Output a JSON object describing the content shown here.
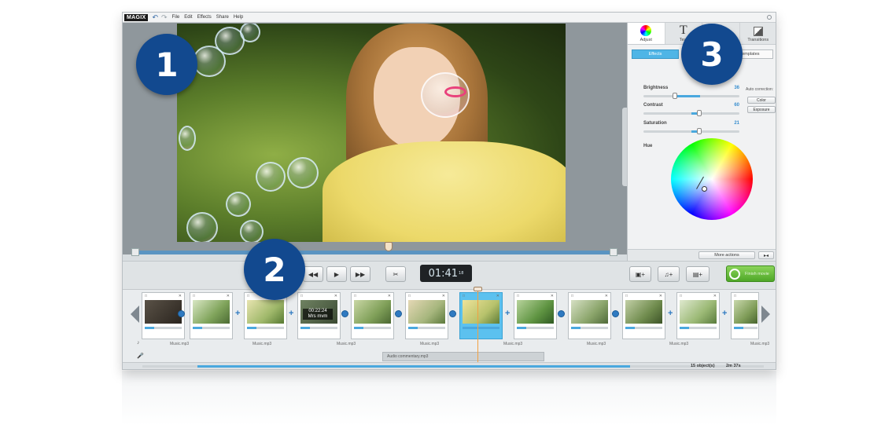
{
  "menubar": {
    "logo": "MAGIX",
    "items": [
      "File",
      "Edit",
      "Effects",
      "Share",
      "Help"
    ]
  },
  "right_panel": {
    "tabs": [
      {
        "label": "Adjust",
        "icon": "color-wheel-icon"
      },
      {
        "label": "Text",
        "icon": "text-icon"
      },
      {
        "label": "",
        "icon": "effects-icon"
      },
      {
        "label": "Transitions",
        "icon": "transitions-icon"
      }
    ],
    "subtabs": {
      "effects": "Effects",
      "templates": "Templates"
    },
    "sliders": [
      {
        "label": "Brightness",
        "value": "36"
      },
      {
        "label": "Contrast",
        "value": "60"
      },
      {
        "label": "Saturation",
        "value": "21"
      }
    ],
    "auto_correction_label": "Auto correction:",
    "color_button": "Color",
    "exposure_button": "Exposure",
    "hue_label": "Hue",
    "more_actions": "More actions",
    "collapse_label": "▸◂"
  },
  "transport": {
    "time": "01:41",
    "frames": "18",
    "export_label": "Finish movie"
  },
  "timeline": {
    "clip_overlay_time": "00:22:24",
    "clip_overlay_sub": "Mrs mvm",
    "music_label": "Music.mp3",
    "audio_commentary": "Audio commentary.mp3",
    "objects_count": "15 object(s)",
    "duration": "2m 37s"
  },
  "callouts": [
    "1",
    "2",
    "3"
  ],
  "colors": {
    "accent_blue": "#4aa8de",
    "callout_blue": "#12498f",
    "export_green": "#5cb531",
    "playhead_orange": "#f2a142"
  }
}
